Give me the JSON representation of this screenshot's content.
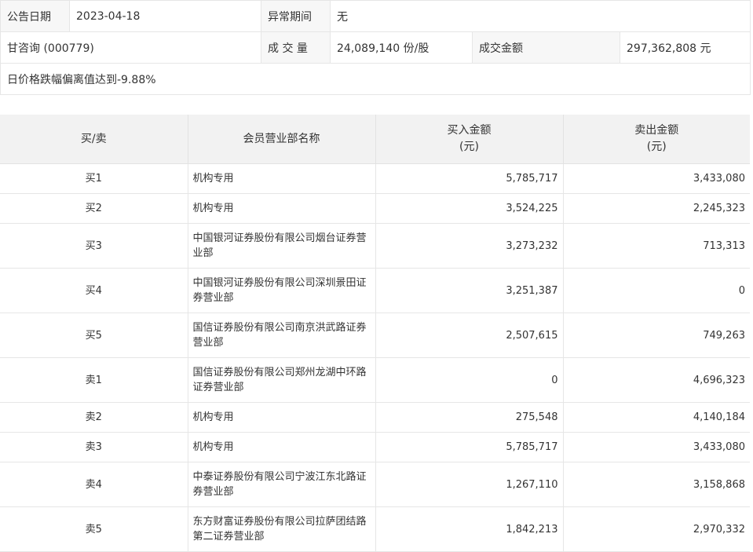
{
  "info": {
    "announce_date_label": "公告日期",
    "announce_date": "2023-04-18",
    "abnormal_period_label": "异常期间",
    "abnormal_period": "无",
    "stock_name": "甘咨询 (000779)",
    "volume_label": "成 交 量",
    "volume": "24,089,140 份/股",
    "amount_label": "成交金额",
    "amount": "297,362,808 元",
    "reason": "日价格跌幅偏离值达到-9.88%"
  },
  "table": {
    "headers": {
      "direction": "买/卖",
      "branch": "会员营业部名称",
      "buy_line1": "买入金额",
      "buy_line2": "(元)",
      "sell_line1": "卖出金额",
      "sell_line2": "(元)"
    },
    "rows": [
      {
        "dir": "买1",
        "name": "机构专用",
        "buy": "5,785,717",
        "sell": "3,433,080"
      },
      {
        "dir": "买2",
        "name": "机构专用",
        "buy": "3,524,225",
        "sell": "2,245,323"
      },
      {
        "dir": "买3",
        "name": "中国银河证券股份有限公司烟台证券营业部",
        "buy": "3,273,232",
        "sell": "713,313"
      },
      {
        "dir": "买4",
        "name": "中国银河证券股份有限公司深圳景田证券营业部",
        "buy": "3,251,387",
        "sell": "0"
      },
      {
        "dir": "买5",
        "name": "国信证券股份有限公司南京洪武路证券营业部",
        "buy": "2,507,615",
        "sell": "749,263"
      },
      {
        "dir": "卖1",
        "name": "国信证券股份有限公司郑州龙湖中环路证券营业部",
        "buy": "0",
        "sell": "4,696,323"
      },
      {
        "dir": "卖2",
        "name": "机构专用",
        "buy": "275,548",
        "sell": "4,140,184"
      },
      {
        "dir": "卖3",
        "name": "机构专用",
        "buy": "5,785,717",
        "sell": "3,433,080"
      },
      {
        "dir": "卖4",
        "name": "中泰证券股份有限公司宁波江东北路证券营业部",
        "buy": "1,267,110",
        "sell": "3,158,868"
      },
      {
        "dir": "卖5",
        "name": "东方财富证券股份有限公司拉萨团结路第二证券营业部",
        "buy": "1,842,213",
        "sell": "2,970,332"
      }
    ]
  }
}
